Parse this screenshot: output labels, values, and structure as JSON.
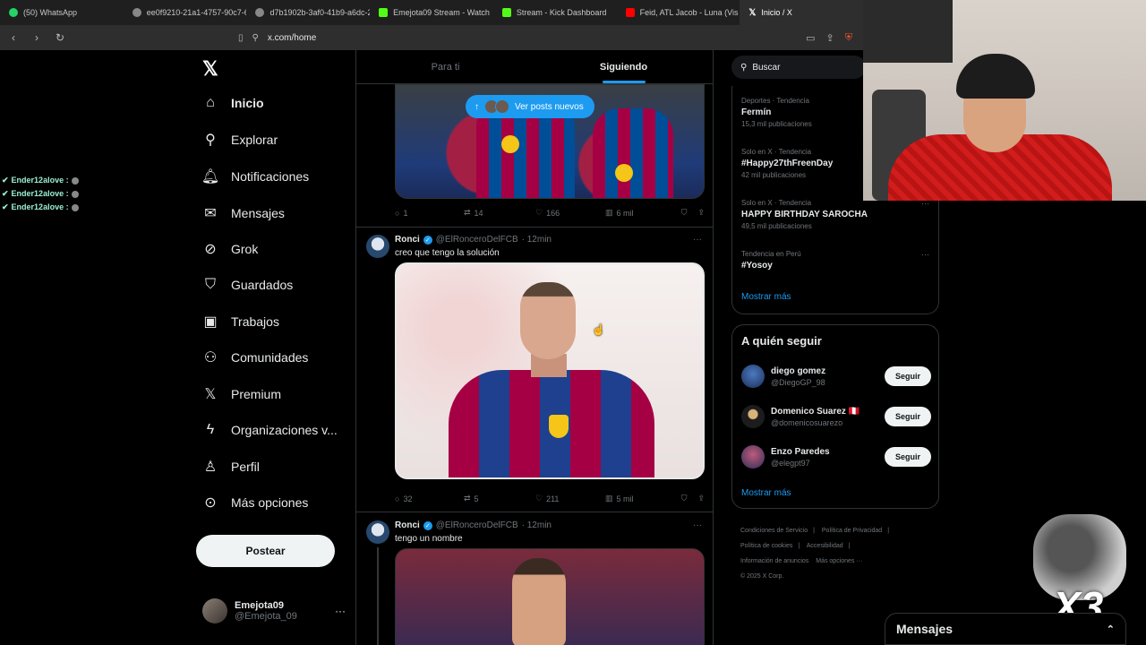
{
  "browser": {
    "tabs": [
      {
        "label": "(50) WhatsApp",
        "color": "#25d366"
      },
      {
        "label": "ee0f9210-21a1-4757-90c7-655",
        "color": "#bbbbbb"
      },
      {
        "label": "d7b1902b-3af0-41b9-a6dc-26",
        "color": "#bbbbbb"
      },
      {
        "label": "Emejota09 Stream - Watch",
        "color": "#53fc18"
      },
      {
        "label": "Stream - Kick Dashboard",
        "color": "#53fc18"
      },
      {
        "label": "Feid, ATL Jacob - Luna (Vis",
        "color": "#ff0000"
      },
      {
        "label": "Inicio / X",
        "color": "#ffffff"
      }
    ],
    "url": "x.com/home"
  },
  "overlay_chat": {
    "rows": [
      "Ender12alove :",
      "Ender12alove :",
      "Ender12alove :"
    ]
  },
  "sidebar": {
    "items": [
      {
        "label": "Inicio",
        "icon": "home-icon"
      },
      {
        "label": "Explorar",
        "icon": "search-icon"
      },
      {
        "label": "Notificaciones",
        "icon": "bell-icon"
      },
      {
        "label": "Mensajes",
        "icon": "mail-icon"
      },
      {
        "label": "Grok",
        "icon": "grok-icon"
      },
      {
        "label": "Guardados",
        "icon": "bookmark-icon"
      },
      {
        "label": "Trabajos",
        "icon": "briefcase-icon"
      },
      {
        "label": "Comunidades",
        "icon": "people-icon"
      },
      {
        "label": "Premium",
        "icon": "x-icon"
      },
      {
        "label": "Organizaciones v...",
        "icon": "bolt-icon"
      },
      {
        "label": "Perfil",
        "icon": "person-icon"
      },
      {
        "label": "Más opciones",
        "icon": "more-circle-icon"
      }
    ],
    "post_label": "Postear",
    "profile": {
      "name": "Emejota09",
      "handle": "@Emejota_09"
    }
  },
  "feed": {
    "tabs": [
      "Para ti",
      "Siguiendo"
    ],
    "new_posts_label": "Ver posts nuevos",
    "tweet0": {
      "replies": "1",
      "retweets": "14",
      "likes": "166",
      "views": "6 mil"
    },
    "tweet1": {
      "name": "Ronci",
      "handle": "@ElRonceroDelFCB",
      "time": "· 12min",
      "text": "creo que tengo la solución",
      "replies": "32",
      "retweets": "5",
      "likes": "211",
      "views": "5 mil"
    },
    "tweet2": {
      "name": "Ronci",
      "handle": "@ElRonceroDelFCB",
      "time": "· 12min",
      "text": "tengo un nombre"
    }
  },
  "right": {
    "search_placeholder": "Buscar",
    "trends": [
      {
        "context": "Deportes · Tendencia",
        "title": "Fermín",
        "count": "15,3 mil publicaciones"
      },
      {
        "context": "Solo en X · Tendencia",
        "title": "#Happy27thFreenDay",
        "count": "42 mil publicaciones"
      },
      {
        "context": "Solo en X · Tendencia",
        "title": "HAPPY BIRTHDAY SAROCHA",
        "count": "49,5 mil publicaciones"
      },
      {
        "context": "Tendencia en Perú",
        "title": "#Yosoy",
        "count": ""
      }
    ],
    "show_more": "Mostrar más",
    "follow_title": "A quién seguir",
    "follow": [
      {
        "name": "diego gomez",
        "handle": "@DiegoGP_98",
        "button": "Seguir",
        "color": "#2a4a8a"
      },
      {
        "name": "Domenico Suarez 🇵🇪",
        "handle": "@domenicosuarezo",
        "button": "Seguir",
        "color": "#1c1c1c"
      },
      {
        "name": "Enzo Paredes",
        "handle": "@elegpt97",
        "button": "Seguir",
        "color": "#3b3f6b"
      }
    ],
    "show_more_2": "Mostrar más",
    "footer": [
      "Condiciones de Servicio",
      "|",
      "Política de Privacidad",
      "|",
      "Política de cookies",
      "|",
      "Accesibilidad",
      "|",
      "Información de anuncios",
      "Más opciones ···",
      "© 2025 X Corp."
    ]
  },
  "overlay": {
    "multiplier": "X3"
  },
  "messages": {
    "label": "Mensajes"
  }
}
